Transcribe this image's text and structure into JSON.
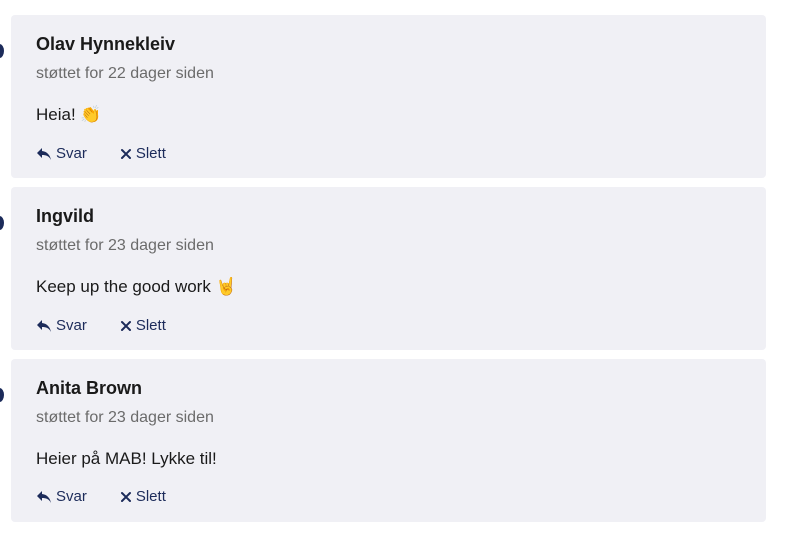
{
  "comments": [
    {
      "author": "Olav Hynnekleiv",
      "time": "støttet for 22 dager siden",
      "text": "Heia!",
      "emoji": "👏"
    },
    {
      "author": "Ingvild",
      "time": "støttet for 23 dager siden",
      "text": "Keep up the good work",
      "emoji": "🤘"
    },
    {
      "author": "Anita Brown",
      "time": "støttet for 23 dager siden",
      "text": "Heier på MAB! Lykke til!",
      "emoji": ""
    }
  ],
  "actions": {
    "reply_label": "Svar",
    "delete_label": "Slett"
  },
  "colors": {
    "card_background": "#f0f0f5",
    "action_color": "#1c2b5a",
    "muted_text": "#6b6b6b"
  },
  "icons": {
    "reply": "reply-arrow-icon",
    "delete": "close-x-icon"
  }
}
